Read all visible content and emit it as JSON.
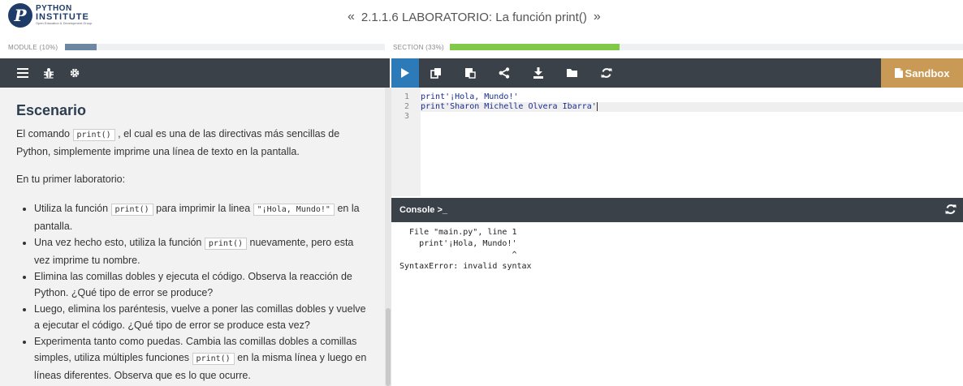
{
  "logo": {
    "line1": "PYTHON",
    "line2": "INSTITUTE",
    "line3": "Open Education & Development Group"
  },
  "nav": {
    "prev": "«",
    "title": "2.1.1.6 LABORATORIO: La función print()",
    "next": "»"
  },
  "progress": {
    "module": {
      "label": "MODULE (10%)",
      "value": 0.1,
      "color": "#6d87a3"
    },
    "section": {
      "label": "SECTION (33%)",
      "value": 0.33,
      "color": "#82c94a"
    }
  },
  "left_toolbar": {
    "icons": [
      "menu-icon",
      "bug-icon",
      "gear-icon"
    ]
  },
  "right_toolbar": {
    "icons": [
      "play-icon",
      "copy-icon",
      "paste-icon",
      "share-icon",
      "download-icon",
      "folder-icon",
      "refresh-icon"
    ],
    "sandbox_label": "Sandbox"
  },
  "content": {
    "heading": "Escenario",
    "intro_a": "El comando",
    "intro_code": "print()",
    "intro_b": ", el cual es una de las directivas más sencillas de Python, simplemente imprime una línea de texto en la pantalla.",
    "lab": "En tu primer laboratorio:",
    "bullets": {
      "b1": {
        "a": "Utiliza la función",
        "code1": "print()",
        "b": "para imprimir la linea",
        "code2": "\"¡Hola, Mundo!\"",
        "c": "en la pantalla."
      },
      "b2": {
        "a": "Una vez hecho esto, utiliza la función",
        "code1": "print()",
        "b": "nuevamente, pero esta vez imprime tu nombre."
      },
      "b3": "Elimina las comillas dobles y ejecuta el código. Observa la reacción de Python. ¿Qué tipo de error se produce?",
      "b4": "Luego, elimina los paréntesis, vuelve a poner las comillas dobles y vuelve a ejecutar el código. ¿Qué tipo de error se produce esta vez?",
      "b5": {
        "a": "Experimenta tanto como puedas. Cambia las comillas dobles a comillas simples, utiliza múltiples funciones",
        "code1": "print()",
        "b": "en la misma línea y luego en líneas diferentes. Observa que es lo que ocurre."
      }
    }
  },
  "editor": {
    "lines": [
      {
        "num": "1",
        "text": "print'¡Hola, Mundo!'"
      },
      {
        "num": "2",
        "text": "print'Sharon Michelle Olvera Ibarra'"
      },
      {
        "num": "3",
        "text": ""
      }
    ]
  },
  "console": {
    "label": "Console >_",
    "output": "  File \"main.py\", line 1\n    print'¡Hola, Mundo!'\n                       ^\nSyntaxError: invalid syntax"
  }
}
